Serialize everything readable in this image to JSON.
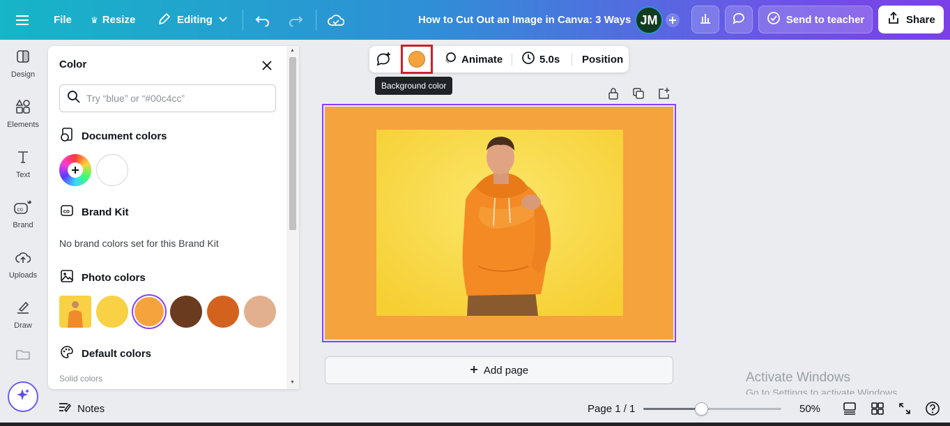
{
  "topbar": {
    "file_label": "File",
    "resize_label": "Resize",
    "editing_label": "Editing",
    "document_title": "How to Cut Out an Image in Canva: 3 Ways",
    "avatar_initials": "JM",
    "send_to_teacher_label": "Send to teacher",
    "share_label": "Share"
  },
  "rail": {
    "items": [
      {
        "label": "Design",
        "icon": "design-icon"
      },
      {
        "label": "Elements",
        "icon": "elements-icon"
      },
      {
        "label": "Text",
        "icon": "text-icon"
      },
      {
        "label": "Brand",
        "icon": "brand-icon"
      },
      {
        "label": "Uploads",
        "icon": "uploads-icon"
      },
      {
        "label": "Draw",
        "icon": "draw-icon"
      }
    ]
  },
  "color_panel": {
    "title": "Color",
    "search_placeholder": "Try “blue” or “#00c4cc”",
    "document_colors_heading": "Document colors",
    "document_colors": [
      "#ffffff"
    ],
    "brand_kit_heading": "Brand Kit",
    "brand_kit_empty": "No brand colors set for this Brand Kit",
    "photo_colors_heading": "Photo colors",
    "photo_colors": [
      "#f8d144",
      "#f4a33d",
      "#6b3b1f",
      "#d4621f",
      "#e2b08e"
    ],
    "selected_photo_color": "#f4a33d",
    "default_colors_heading": "Default colors",
    "solid_colors_label": "Solid colors"
  },
  "floating_toolbar": {
    "background_color": "#f4a33d",
    "animate_label": "Animate",
    "duration_label": "5.0s",
    "position_label": "Position",
    "tooltip": "Background color"
  },
  "canvas": {
    "page_background": "#f4a33d",
    "add_page_label": "Add page"
  },
  "bottombar": {
    "notes_label": "Notes",
    "page_indicator": "Page 1 / 1",
    "zoom_label": "50%",
    "zoom_fraction": 0.42
  },
  "watermark": {
    "line1": "Activate Windows",
    "line2": "Go to Settings to activate Windows."
  }
}
